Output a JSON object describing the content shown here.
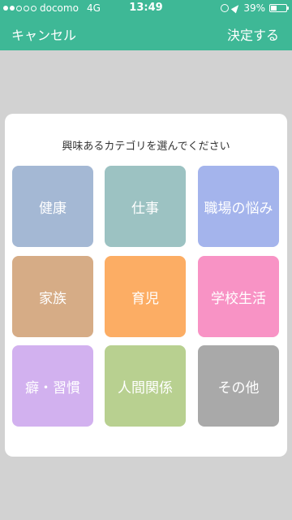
{
  "status": {
    "carrier": "docomo",
    "network": "4G",
    "time": "13:49",
    "battery_text": "39%",
    "battery_level": 0.39,
    "signal_bars": 2
  },
  "header": {
    "cancel_label": "キャンセル",
    "confirm_label": "決定する",
    "bg_color": "#3eb896"
  },
  "dialog": {
    "title": "興味あるカテゴリを選んでください",
    "categories": [
      {
        "label": "健康",
        "color": "#a4b8d4"
      },
      {
        "label": "仕事",
        "color": "#9cc2c2"
      },
      {
        "label": "職場の悩み",
        "color": "#a4b4ec"
      },
      {
        "label": "家族",
        "color": "#d6ac86"
      },
      {
        "label": "育児",
        "color": "#fcad64"
      },
      {
        "label": "学校生活",
        "color": "#f893c5"
      },
      {
        "label": "癖・習慣",
        "color": "#d2b1ef"
      },
      {
        "label": "人間関係",
        "color": "#b8d090"
      },
      {
        "label": "その他",
        "color": "#a9a9a9"
      }
    ]
  }
}
